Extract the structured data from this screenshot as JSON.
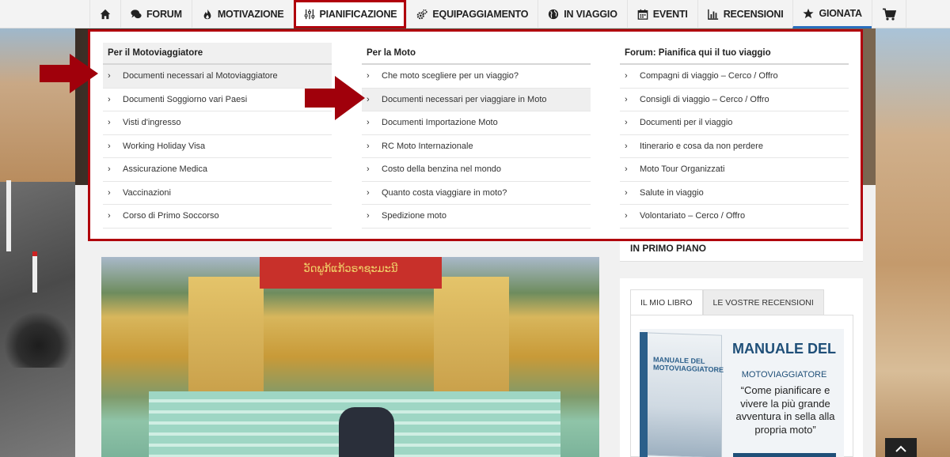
{
  "nav": {
    "items": [
      {
        "icon": "home-icon",
        "label": ""
      },
      {
        "icon": "chat-icon",
        "label": "FORUM"
      },
      {
        "icon": "fire-icon",
        "label": "MOTIVAZIONE"
      },
      {
        "icon": "sliders-icon",
        "label": "PIANIFICAZIONE"
      },
      {
        "icon": "gears-icon",
        "label": "EQUIPAGGIAMENTO"
      },
      {
        "icon": "globe-icon",
        "label": "IN VIAGGIO"
      },
      {
        "icon": "calendar-icon",
        "label": "EVENTI"
      },
      {
        "icon": "chart-icon",
        "label": "RECENSIONI"
      },
      {
        "icon": "star-icon",
        "label": "GIONATA"
      },
      {
        "icon": "cart-icon",
        "label": ""
      }
    ],
    "active": "PIANIFICAZIONE",
    "highlight_color": "#b0000c"
  },
  "mega_menu": {
    "columns": [
      {
        "title": "Per il Motoviaggiatore",
        "items": [
          "Documenti necessari al Motoviaggiatore",
          "Documenti Soggiorno vari Paesi",
          "Visti d'ingresso",
          "Working Holiday Visa",
          "Assicurazione Medica",
          "Vaccinazioni",
          "Corso di Primo Soccorso"
        ]
      },
      {
        "title": "Per la Moto",
        "items": [
          "Che moto scegliere per un viaggio?",
          "Documenti necessari per viaggiare in Moto",
          "Documenti Importazione Moto",
          "RC Moto Internazionale",
          "Costo della benzina nel mondo",
          "Quanto costa viaggiare in moto?",
          "Spedizione moto"
        ]
      },
      {
        "title": "Forum: Pianifica qui il tuo viaggio",
        "items": [
          "Compagni di viaggio – Cerco / Offro",
          "Consigli di viaggio – Cerco / Offro",
          "Documenti per il viaggio",
          "Itinerario e cosa da non perdere",
          "Moto Tour Organizzati",
          "Salute in viaggio",
          "Volontariato – Cerco / Offro"
        ]
      }
    ]
  },
  "article": {
    "temple_sign": "ວັດພູກ້ແກ້ວຣາຊະມະນີ"
  },
  "sidebar": {
    "title": "IN PRIMO PIANO",
    "tabs": [
      "IL MIO LIBRO",
      "LE VOSTRE RECENSIONI"
    ],
    "book": {
      "cover_title": "MANUALE DEL MOTOVIAGGIATORE",
      "title": "MANUALE DEL",
      "subtitle": "MOTOVIAGGIATORE",
      "quote": "“Come pianificare e vivere la più grande avventura in sella alla propria moto”"
    }
  }
}
